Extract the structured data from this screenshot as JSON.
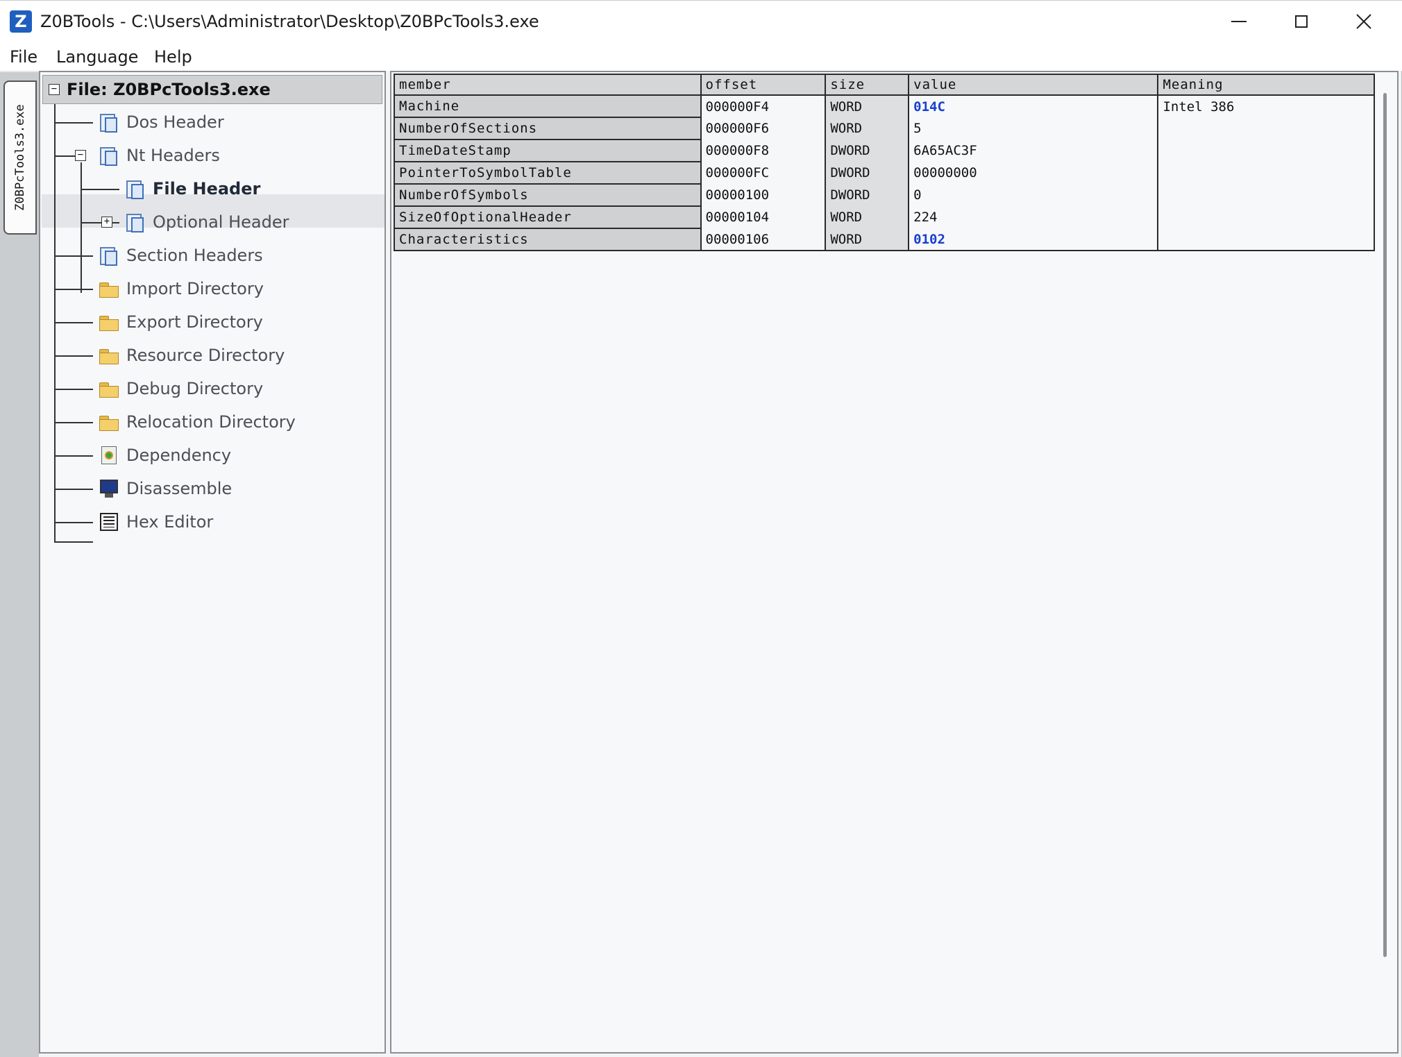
{
  "window": {
    "title": "Z0BTools - C:\\Users\\Administrator\\Desktop\\Z0BPcTools3.exe",
    "icon": "z-logo-icon"
  },
  "menu": {
    "file": "File",
    "language": "Language",
    "help": "Help"
  },
  "file_tab": {
    "label": "Z0BPcTools3.exe"
  },
  "tree": {
    "root": "File: Z0BPcTools3.exe",
    "items": {
      "dos_header": "Dos Header",
      "nt_headers": "Nt Headers",
      "file_header": "File Header",
      "optional_header": "Optional Header",
      "section_headers": "Section Headers",
      "import_directory": "Import Directory",
      "export_directory": "Export Directory",
      "resource_directory": "Resource Directory",
      "debug_directory": "Debug Directory",
      "relocation_directory": "Relocation Directory",
      "dependency": "Dependency",
      "disassemble": "Disassemble",
      "hex_editor": "Hex Editor"
    },
    "selected": "File Header"
  },
  "grid": {
    "headers": [
      "member",
      "offset",
      "size",
      "value",
      "Meaning"
    ],
    "rows": [
      {
        "member": "Machine",
        "offset": "000000F4",
        "size": "WORD",
        "value": "014C",
        "meaning": "Intel 386"
      },
      {
        "member": "NumberOfSections",
        "offset": "000000F6",
        "size": "WORD",
        "value": "5",
        "meaning": ""
      },
      {
        "member": "TimeDateStamp",
        "offset": "000000F8",
        "size": "DWORD",
        "value": "6A65AC3F",
        "meaning": ""
      },
      {
        "member": "PointerToSymbolTable",
        "offset": "000000FC",
        "size": "DWORD",
        "value": "00000000",
        "meaning": ""
      },
      {
        "member": "NumberOfSymbols",
        "offset": "00000100",
        "size": "DWORD",
        "value": "0",
        "meaning": ""
      },
      {
        "member": "SizeOfOptionalHeader",
        "offset": "00000104",
        "size": "WORD",
        "value": "224",
        "meaning": ""
      },
      {
        "member": "Characteristics",
        "offset": "00000106",
        "size": "WORD",
        "value": "0102",
        "meaning": ""
      }
    ]
  },
  "colors": {
    "highlight_value": "#1a3fcf",
    "header_bg": "#d4d6d8"
  }
}
